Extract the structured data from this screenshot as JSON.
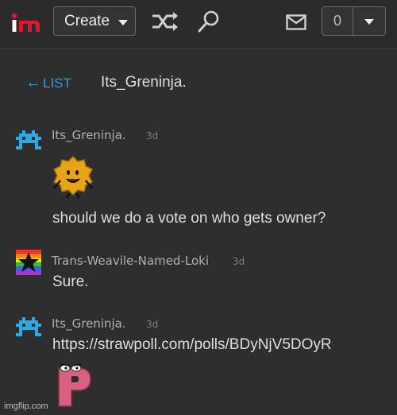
{
  "header": {
    "logo_text": "im",
    "create_label": "Create",
    "notification_count": "0"
  },
  "chat": {
    "back_label": "LIST",
    "back_arrow": "←",
    "title": "Its_Greninja."
  },
  "messages": [
    {
      "user": "Its_Greninja.",
      "time": "3d",
      "text": "should we do a vote on who gets owner?",
      "sticker": "golden-character-sticker"
    },
    {
      "user": "Trans-Weavile-Named-Loki",
      "time": "3d",
      "text": "Sure."
    },
    {
      "user": "Its_Greninja.",
      "time": "3d",
      "text": "https://strawpoll.com/polls/BDyNjV5DOyR",
      "sticker": "pink-letter-p-sticker"
    }
  ],
  "footer": {
    "watermark": "imgflip.com"
  },
  "colors": {
    "background": "#2e2e2e",
    "link": "#2a9fd8",
    "logo_red": "#e5142c",
    "avatar_blue": "#2fa8e8"
  },
  "icons": [
    "shuffle-icon",
    "search-icon",
    "mail-icon",
    "chevron-down-icon"
  ]
}
